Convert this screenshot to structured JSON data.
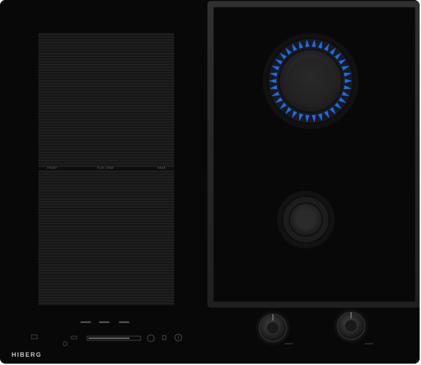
{
  "brand": "HIBERG",
  "zone_labels": {
    "left": "front",
    "middle": "flex zone",
    "right": "rear"
  },
  "scene": {
    "background_color": "#ffffff",
    "hob_color": "#080808",
    "induction_pad_color": "#1a1a1a",
    "grate_color": "#2a2a2a",
    "flame_color": "#1a6bff"
  }
}
